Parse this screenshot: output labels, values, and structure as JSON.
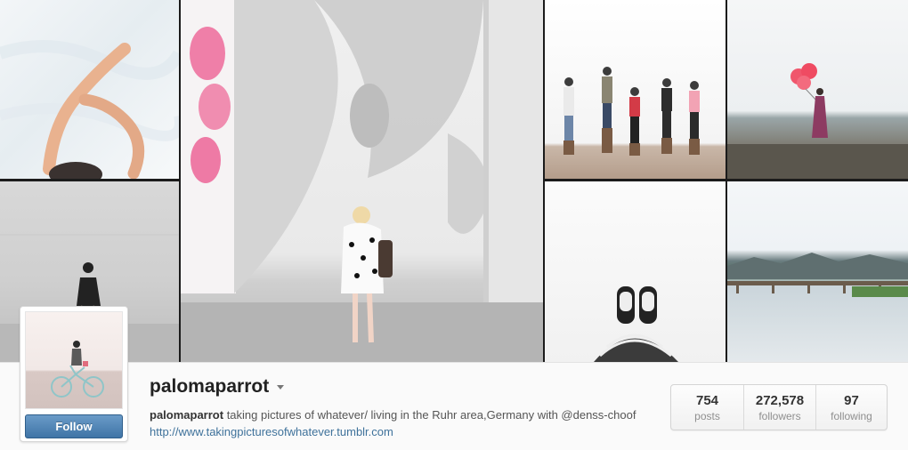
{
  "profile": {
    "username": "palomaparrot",
    "follow_label": "Follow",
    "bio_username": "palomaparrot",
    "bio_text": " taking pictures of whatever/ living in the Ruhr area,Germany with @denss-choof ",
    "website": "http://www.takingpicturesofwhatever.tumblr.com"
  },
  "stats": [
    {
      "count": "754",
      "label": "posts"
    },
    {
      "count": "272,578",
      "label": "followers"
    },
    {
      "count": "97",
      "label": "following"
    }
  ],
  "colors": {
    "follow_button": "#3f74a6",
    "link": "#3f729b",
    "balloon": "#f0566c",
    "mural_pink": "#ef7fa8"
  },
  "icons": {
    "username_menu": "caret-down-icon"
  }
}
